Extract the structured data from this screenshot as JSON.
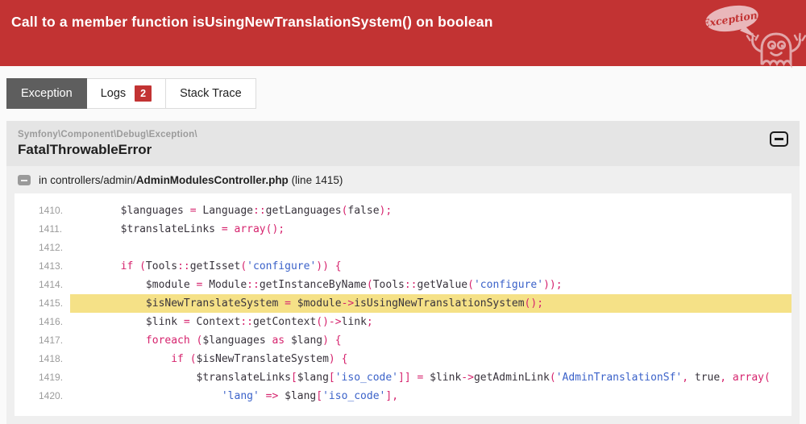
{
  "colors": {
    "header_bg": "#c23333",
    "badge_bg": "#c23333",
    "tab_active_bg": "#5e5e5e",
    "code_default": "#38333c",
    "code_keyword": "#d6246e",
    "code_string": "#3b62c9",
    "line_highlight": "#f5e187",
    "mascot_outline": "#e2a6a9",
    "bubble_fill": "#e9b7ba"
  },
  "header": {
    "title": "Call to a member function isUsingNewTranslationSystem() on boolean",
    "mascot": {
      "icon": "ghost-exception-mascot",
      "bubble_text": "Exception!"
    }
  },
  "tabs": [
    {
      "label": "Exception",
      "active": true
    },
    {
      "label": "Logs",
      "active": false,
      "badge": "2"
    },
    {
      "label": "Stack Trace",
      "active": false
    }
  ],
  "exception": {
    "namespace": "Symfony\\Component\\Debug\\Exception\\",
    "class": "FatalThrowableError",
    "collapse_icon": "collapse-minus-icon",
    "location": {
      "prefix": "in controllers/admin/",
      "file": "AdminModulesController.php",
      "line_suffix": " (line 1415)"
    }
  },
  "code": {
    "highlight_line": "1415.",
    "lines": [
      {
        "no": "1410.",
        "tokens": [
          [
            "d",
            "        $languages "
          ],
          [
            "k",
            "="
          ],
          [
            "d",
            " Language"
          ],
          [
            "k",
            "::"
          ],
          [
            "d",
            "getLanguages"
          ],
          [
            "k",
            "("
          ],
          [
            "d",
            "false"
          ],
          [
            "k",
            ");"
          ]
        ]
      },
      {
        "no": "1411.",
        "tokens": [
          [
            "d",
            "        $translateLinks "
          ],
          [
            "k",
            "="
          ],
          [
            "d",
            " "
          ],
          [
            "k",
            "array();"
          ]
        ]
      },
      {
        "no": "1412.",
        "tokens": []
      },
      {
        "no": "1413.",
        "tokens": [
          [
            "k",
            "        if ("
          ],
          [
            "d",
            "Tools"
          ],
          [
            "k",
            "::"
          ],
          [
            "d",
            "getIsset"
          ],
          [
            "k",
            "("
          ],
          [
            "s",
            "'configure'"
          ],
          [
            "k",
            ")) {"
          ]
        ]
      },
      {
        "no": "1414.",
        "tokens": [
          [
            "d",
            "            $module "
          ],
          [
            "k",
            "="
          ],
          [
            "d",
            " Module"
          ],
          [
            "k",
            "::"
          ],
          [
            "d",
            "getInstanceByName"
          ],
          [
            "k",
            "("
          ],
          [
            "d",
            "Tools"
          ],
          [
            "k",
            "::"
          ],
          [
            "d",
            "getValue"
          ],
          [
            "k",
            "("
          ],
          [
            "s",
            "'configure'"
          ],
          [
            "k",
            "));"
          ]
        ]
      },
      {
        "no": "1415.",
        "tokens": [
          [
            "d",
            "            $isNewTranslateSystem "
          ],
          [
            "k",
            "="
          ],
          [
            "d",
            " $module"
          ],
          [
            "k",
            "->"
          ],
          [
            "d",
            "isUsingNewTranslationSystem"
          ],
          [
            "k",
            "();"
          ]
        ]
      },
      {
        "no": "1416.",
        "tokens": [
          [
            "d",
            "            $link "
          ],
          [
            "k",
            "="
          ],
          [
            "d",
            " Context"
          ],
          [
            "k",
            "::"
          ],
          [
            "d",
            "getContext"
          ],
          [
            "k",
            "()->"
          ],
          [
            "d",
            "link"
          ],
          [
            "k",
            ";"
          ]
        ]
      },
      {
        "no": "1417.",
        "tokens": [
          [
            "k",
            "            foreach ("
          ],
          [
            "d",
            "$languages"
          ],
          [
            "k",
            " as "
          ],
          [
            "d",
            "$lang"
          ],
          [
            "k",
            ") {"
          ]
        ]
      },
      {
        "no": "1418.",
        "tokens": [
          [
            "k",
            "                if ("
          ],
          [
            "d",
            "$isNewTranslateSystem"
          ],
          [
            "k",
            ") {"
          ]
        ]
      },
      {
        "no": "1419.",
        "tokens": [
          [
            "d",
            "                    $translateLinks"
          ],
          [
            "k",
            "["
          ],
          [
            "d",
            "$lang"
          ],
          [
            "k",
            "["
          ],
          [
            "s",
            "'iso_code'"
          ],
          [
            "k",
            "]] ="
          ],
          [
            "d",
            " $link"
          ],
          [
            "k",
            "->"
          ],
          [
            "d",
            "getAdminLink"
          ],
          [
            "k",
            "("
          ],
          [
            "s",
            "'AdminTranslationSf'"
          ],
          [
            "k",
            ", "
          ],
          [
            "d",
            "true"
          ],
          [
            "k",
            ", array("
          ]
        ]
      },
      {
        "no": "1420.",
        "tokens": [
          [
            "d",
            "                        "
          ],
          [
            "s",
            "'lang'"
          ],
          [
            "k",
            " =>"
          ],
          [
            "d",
            " $lang"
          ],
          [
            "k",
            "["
          ],
          [
            "s",
            "'iso_code'"
          ],
          [
            "k",
            "],"
          ]
        ]
      }
    ]
  }
}
